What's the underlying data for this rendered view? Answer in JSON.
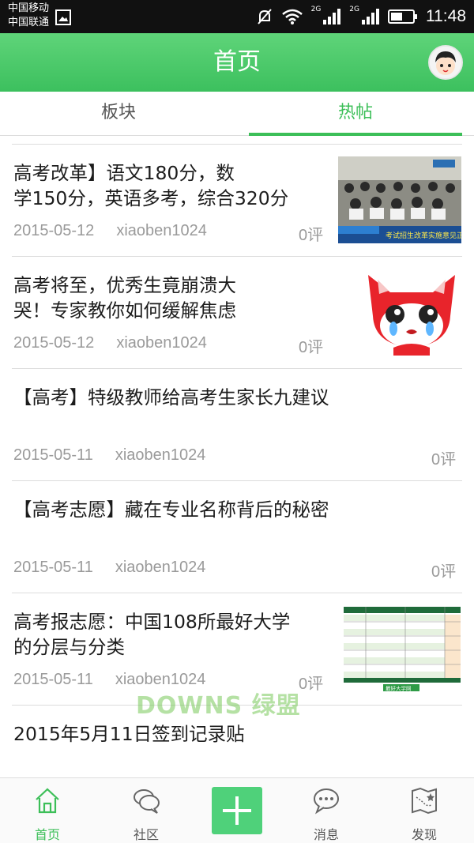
{
  "status_bar": {
    "carrier_1": "中国移动",
    "carrier_2": "中国联通",
    "net_1": "2G",
    "net_2": "2G",
    "time": "11:48"
  },
  "header": {
    "title": "首页"
  },
  "tabs": [
    {
      "label": "板块",
      "active": false
    },
    {
      "label": "热帖",
      "active": true
    }
  ],
  "posts": [
    {
      "title_line1": "高考改革】语文180分，数",
      "title_line2": "学150分，英语多考，综合320分",
      "date": "2015-05-12",
      "author": "xiaoben1024",
      "comments": "0评",
      "thumb_text": "考试招生改革实施意见正式发布"
    },
    {
      "title_line1": "高考将至，优秀生竟崩溃大",
      "title_line2": "哭！专家教你如何缓解焦虑",
      "date": "2015-05-12",
      "author": "xiaoben1024",
      "comments": "0评"
    },
    {
      "title_line1": "【高考】特级教师给高考生家长九建议",
      "title_line2": "",
      "date": "2015-05-11",
      "author": "xiaoben1024",
      "comments": "0评"
    },
    {
      "title_line1": "【高考志愿】藏在专业名称背后的秘密",
      "title_line2": "",
      "date": "2015-05-11",
      "author": "xiaoben1024",
      "comments": "0评"
    },
    {
      "title_line1": "高考报志愿：中国108所最好大学",
      "title_line2": "的分层与分类",
      "date": "2015-05-11",
      "author": "xiaoben1024",
      "comments": "0评",
      "thumb_text": "最好大学网"
    },
    {
      "title_line1": "2015年5月11日签到记录贴",
      "title_line2": "",
      "date": "",
      "author": "",
      "comments": ""
    }
  ],
  "watermark": "DOWNS 绿盟",
  "bottom_nav": [
    {
      "label": "首页",
      "icon": "home-icon",
      "active": true
    },
    {
      "label": "社区",
      "icon": "chat-bubbles-icon",
      "active": false
    },
    {
      "label": "",
      "icon": "plus-icon",
      "active": false
    },
    {
      "label": "消息",
      "icon": "message-icon",
      "active": false
    },
    {
      "label": "发现",
      "icon": "map-icon",
      "active": false
    }
  ],
  "colors": {
    "accent": "#3cbf58",
    "header": "#4ccb6b",
    "plus_button": "#4fd17a",
    "meta_text": "#9a9a9a"
  }
}
